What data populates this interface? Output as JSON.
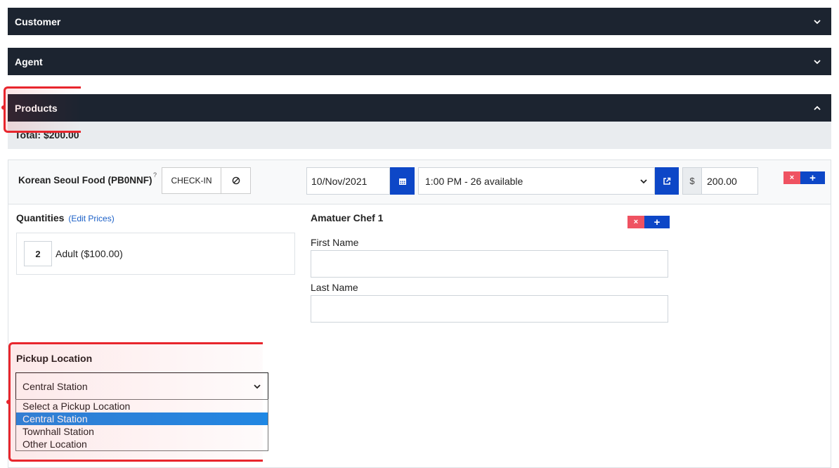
{
  "sections": {
    "customer": {
      "label": "Customer"
    },
    "agent": {
      "label": "Agent"
    },
    "products": {
      "label": "Products"
    }
  },
  "total": {
    "label": "Total: $200.00"
  },
  "product": {
    "name": "Korean Seoul Food (PB0NNF)",
    "help_mark": "?",
    "checkin_label": "CHECK-IN",
    "date_value": "10/Nov/2021",
    "time_value": "1:00 PM - 26 available",
    "currency_symbol": "$",
    "price_value": "200.00",
    "remove_label": "×",
    "add_label": "+"
  },
  "quantities": {
    "title": "Quantities",
    "edit_link": "(Edit Prices)",
    "items": [
      {
        "qty": "2",
        "label": "Adult ($100.00)"
      }
    ]
  },
  "participant": {
    "title": "Amatuer Chef 1",
    "first_name_label": "First Name",
    "last_name_label": "Last Name",
    "first_name_value": "",
    "last_name_value": "",
    "remove_label": "×",
    "add_label": "+"
  },
  "pickup": {
    "title": "Pickup Location",
    "selected": "Central Station",
    "options": [
      "Select a Pickup Location",
      "Central Station",
      "Townhall Station",
      "Other Location"
    ]
  },
  "colors": {
    "header_bg": "#1c2430",
    "accent_blue": "#0d47c7",
    "danger": "#ef5261",
    "highlight": "#1e88e5",
    "annotation": "#e8262d"
  },
  "icons": {
    "chevron": "chevron-down-icon",
    "calendar": "calendar-icon",
    "external": "external-link-icon",
    "block": "ban-icon"
  }
}
